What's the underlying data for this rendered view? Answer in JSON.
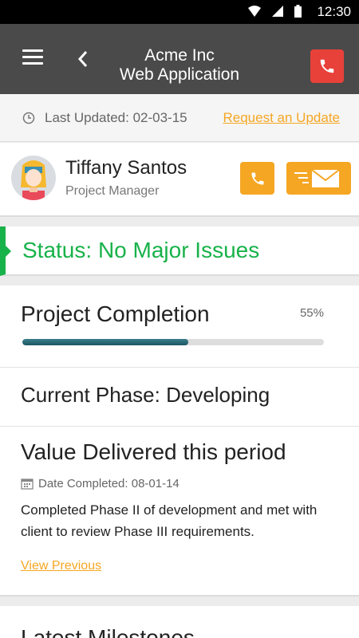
{
  "status_bar": {
    "time": "12:30"
  },
  "app_bar": {
    "title_line1": "Acme Inc",
    "title_line2": "Web Application"
  },
  "update_bar": {
    "last_updated": "Last Updated: 02-03-15",
    "request_link": "Request an Update"
  },
  "contact": {
    "name": "Tiffany Santos",
    "role": "Project Manager"
  },
  "status": {
    "text": "Status: No Major Issues",
    "color": "#18b24a"
  },
  "completion": {
    "title": "Project Completion",
    "percent_label": "55%",
    "percent": 0.55
  },
  "phase": {
    "text": "Current Phase: Developing"
  },
  "value": {
    "title": "Value Delivered this period",
    "date_completed": "Date Completed: 08-01-14",
    "description": "Completed Phase II of development and met with client to review Phase III requirements.",
    "view_previous": "View Previous"
  },
  "milestones": {
    "title": "Latest Milestones"
  },
  "colors": {
    "accent": "#f5a623",
    "danger": "#e8413a",
    "appbar": "#4a4a4a",
    "progress": "#1d5663"
  }
}
